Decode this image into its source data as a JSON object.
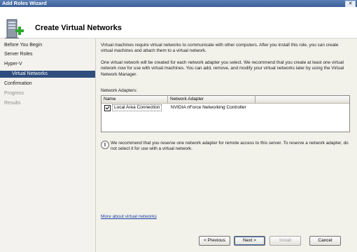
{
  "window": {
    "title": "Add Roles Wizard",
    "close_glyph": "✕"
  },
  "header": {
    "title": "Create Virtual Networks",
    "icon": "server-add-icon"
  },
  "sidebar": {
    "items": [
      {
        "label": "Before You Begin",
        "state": "normal"
      },
      {
        "label": "Server Roles",
        "state": "normal"
      },
      {
        "label": "Hyper-V",
        "state": "normal"
      },
      {
        "label": "Virtual Networks",
        "state": "selected"
      },
      {
        "label": "Confirmation",
        "state": "normal"
      },
      {
        "label": "Progress",
        "state": "disabled"
      },
      {
        "label": "Results",
        "state": "disabled"
      }
    ]
  },
  "main": {
    "para1": "Virtual machines require virtual networks to communicate with other computers. After you install this role, you can create virtual machines and attach them to a virtual network.",
    "para2": "One virtual network will be created for each network adapter you select. We recommend that you create at least one virtual network now for use with virtual machines. You can add, remove, and modify your virtual networks later by using the Virtual Network Manager.",
    "adapters_label": "Network Adapters:",
    "columns": [
      "Name",
      "Network Adapter"
    ],
    "rows": [
      {
        "checked": true,
        "name": "Local Area Connection",
        "adapter": "NVIDIA nForce Networking Controller"
      }
    ],
    "info_text": "We recommend that you reserve one network adapter for remote access to this server. To reserve a network adapter, do not select it for use with a virtual network.",
    "link": "More about virtual networks"
  },
  "buttons": {
    "previous": "< Previous",
    "next": "Next >",
    "install": "Install",
    "cancel": "Cancel"
  },
  "colors": {
    "accent": "#2f4d7d",
    "title_bar": "#3b5f96",
    "link": "#1a3fa3",
    "plus": "#2eaa2e"
  }
}
